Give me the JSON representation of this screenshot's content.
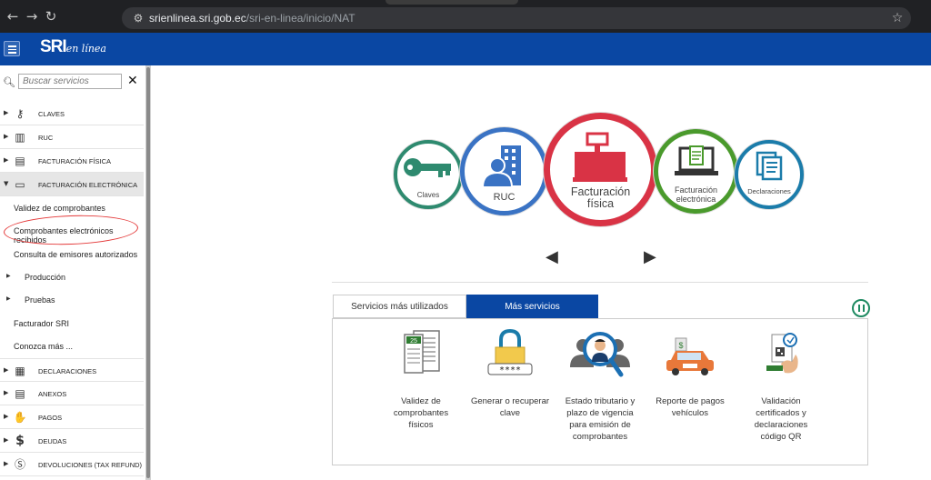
{
  "browser": {
    "back_icon": "arrow-left-icon",
    "forward_icon": "arrow-right-icon",
    "reload_icon": "reload-icon",
    "url_host": "srienlinea.sri.gob.ec",
    "url_path": "/sri-en-linea/inicio/NAT",
    "bookmark_icon": "star-icon"
  },
  "header": {
    "logo_main": "SRI",
    "logo_sub": "en línea"
  },
  "sidebar": {
    "search_placeholder": "Buscar servicios",
    "close_label": "✕",
    "items": [
      {
        "label": "CLAVES",
        "icon": "key-icon"
      },
      {
        "label": "RUC",
        "icon": "building-icon"
      },
      {
        "label": "FACTURACIÓN FÍSICA",
        "icon": "cash-register-icon"
      },
      {
        "label": "FACTURACIÓN ELECTRÓNICA",
        "icon": "laptop-invoice-icon"
      },
      {
        "label": "DECLARACIONES",
        "icon": "document-stack-icon"
      },
      {
        "label": "ANEXOS",
        "icon": "file-icon"
      },
      {
        "label": "PAGOS",
        "icon": "payment-icon"
      },
      {
        "label": "DEUDAS",
        "icon": "dollar-icon"
      },
      {
        "label": "DEVOLUCIONES (TAX REFUND)",
        "icon": "dollar-circle-icon"
      }
    ],
    "subitems": [
      "Validez de comprobantes",
      "Comprobantes electrónicos recibidos",
      "Consulta de emisores autorizados",
      "Producción",
      "Pruebas",
      "Facturador SRI",
      "Conozca más ..."
    ]
  },
  "carousel": {
    "items": [
      {
        "label": "Claves",
        "color": "#2e8a6f"
      },
      {
        "label": "RUC",
        "color": "#3a73c4"
      },
      {
        "label": "Facturación física",
        "color": "#d93345"
      },
      {
        "label": "Facturación electrónica",
        "color": "#4a9a2c"
      },
      {
        "label": "Declaraciones",
        "color": "#1b7caa"
      }
    ]
  },
  "tabs": {
    "t1": "Servicios más utilizados",
    "t2": "Más servicios"
  },
  "services": [
    {
      "line1": "Validez de",
      "line2": "comprobantes",
      "line3": "físicos",
      "line4": ""
    },
    {
      "line1": "Generar o recuperar",
      "line2": "clave",
      "line3": "",
      "line4": ""
    },
    {
      "line1": "Estado tributario y",
      "line2": "plazo de vigencia",
      "line3": "para emisión de",
      "line4": "comprobantes"
    },
    {
      "line1": "Reporte de pagos",
      "line2": "vehículos",
      "line3": "",
      "line4": ""
    },
    {
      "line1": "Validación",
      "line2": "certificados y",
      "line3": "declaraciones",
      "line4": "código QR"
    }
  ],
  "service_calendar_day": "25",
  "service_password_mask": "****"
}
